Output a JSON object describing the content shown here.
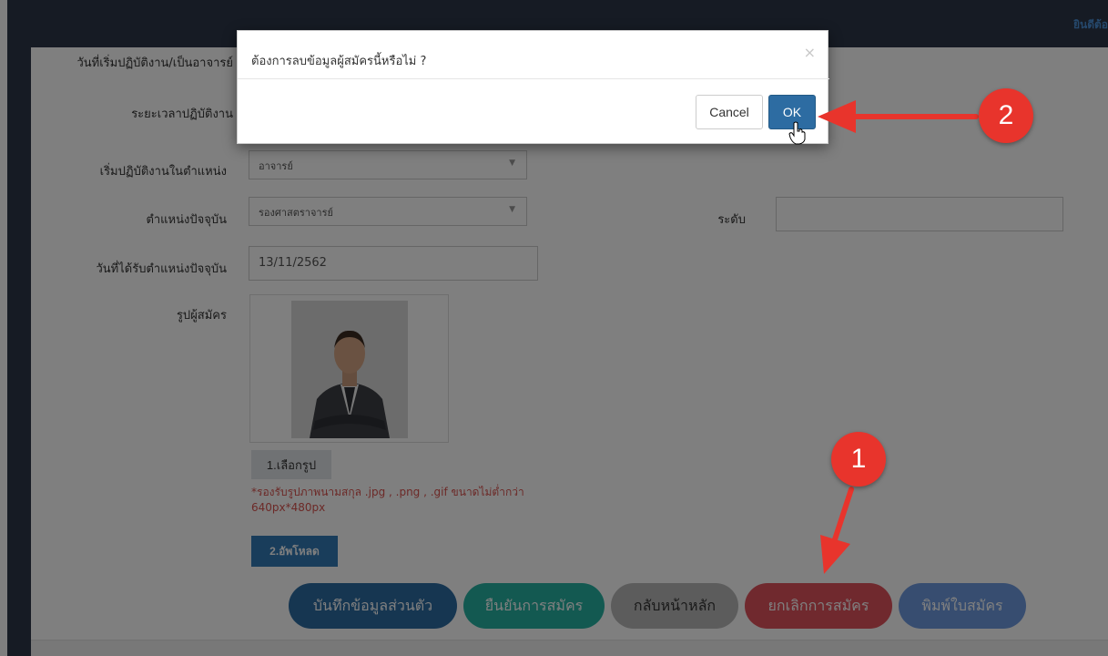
{
  "topbar": {
    "user_text": "ยินดีต้อ"
  },
  "form": {
    "label_start_teacher": "วันที่เริ่มปฏิบัติงาน/เป็นอาจารย์",
    "label_duration": "ระยะเวลาปฏิบัติงาน",
    "label_start_position": "เริ่มปฏิบัติงานในตำแหน่ง",
    "start_position_value": "อาจารย์",
    "label_current_position": "ตำแหน่งปัจจุบัน",
    "current_position_value": "รองศาสตราจารย์",
    "label_level": "ระดับ",
    "level_value": "",
    "label_position_date": "วันที่ได้รับตำแหน่งปัจจุบัน",
    "position_date_value": "13/11/2562",
    "label_photo": "รูปผู้สมัคร",
    "choose_photo_label": "1.เลือกรูป",
    "image_note": "*รองรับรูปภาพนามสกุล .jpg , .png , .gif ขนาดไม่ต่ำกว่า 640px*480px",
    "upload_label": "2.อัพโหลด"
  },
  "actions": {
    "save_label": "บันทึกข้อมูลส่วนตัว",
    "confirm_label": "ยืนยันการสมัคร",
    "home_label": "กลับหน้าหลัก",
    "cancel_app_label": "ยกเลิกการสมัคร",
    "print_label": "พิมพ์ใบสมัคร"
  },
  "modal": {
    "message": "ต้องการลบข้อมูลผู้สมัครนี้หรือไม่ ?",
    "close_glyph": "×",
    "cancel_label": "Cancel",
    "ok_label": "OK"
  },
  "annotations": {
    "step1": "1",
    "step2": "2"
  },
  "colors": {
    "navbar": "#2d3748",
    "primary": "#2d6ca2",
    "teal": "#26b3a3",
    "gray": "#b9b9b9",
    "danger": "#e0525c",
    "print": "#6f9be0",
    "annotation": "#e8342c"
  }
}
